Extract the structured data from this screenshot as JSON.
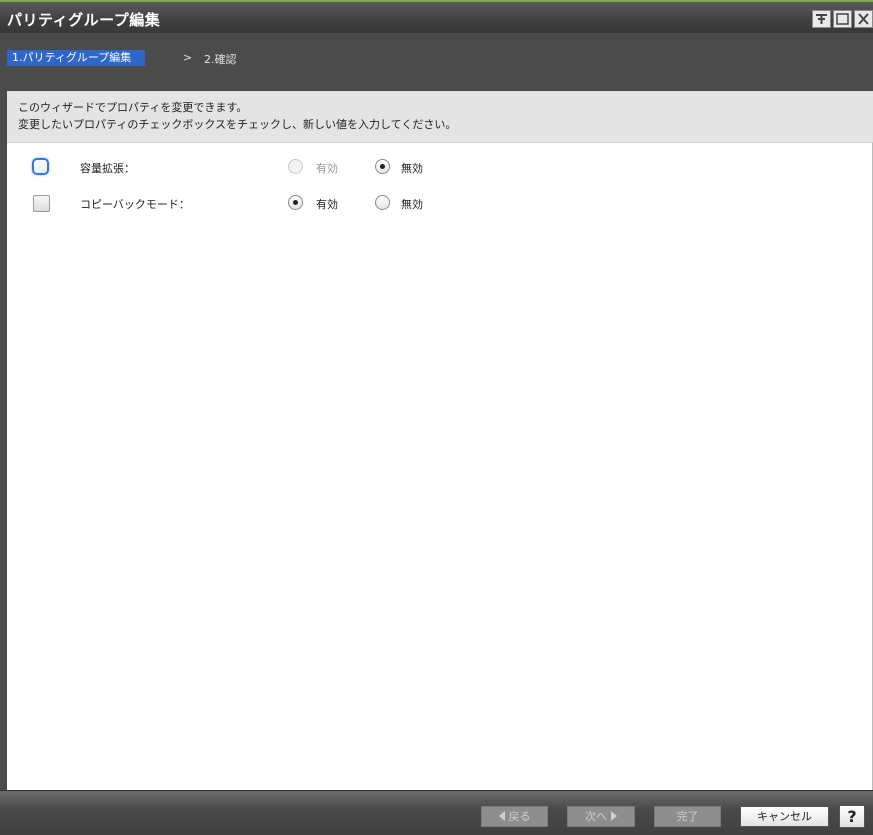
{
  "window": {
    "title": "パリティグループ編集",
    "controls": [
      "pin-icon",
      "maximize-icon",
      "close-icon"
    ]
  },
  "steps": {
    "current": "1.パリティグループ編集",
    "separator": ">",
    "next": "2.確認"
  },
  "description": {
    "line1": "このウィザードでプロパティを変更できます。",
    "line2": "変更したいプロパティのチェックボックスをチェックし、新しい値を入力してください。"
  },
  "properties": [
    {
      "label": "容量拡張：",
      "checked": false,
      "enabled_label": "有効",
      "disabled_label": "無効",
      "selected": "無効",
      "enabled_option_available": false
    },
    {
      "label": "コピーバックモード：",
      "checked": false,
      "enabled_label": "有効",
      "disabled_label": "無効",
      "selected": "有効",
      "enabled_option_available": true
    }
  ],
  "footer": {
    "back": "戻る",
    "next": "次へ",
    "finish": "完了",
    "cancel": "キャンセル",
    "help": "?"
  },
  "colors": {
    "accent": "#2e67c8",
    "titlebar": "#3f3f3f",
    "top_stripe": "#7fa84a"
  }
}
